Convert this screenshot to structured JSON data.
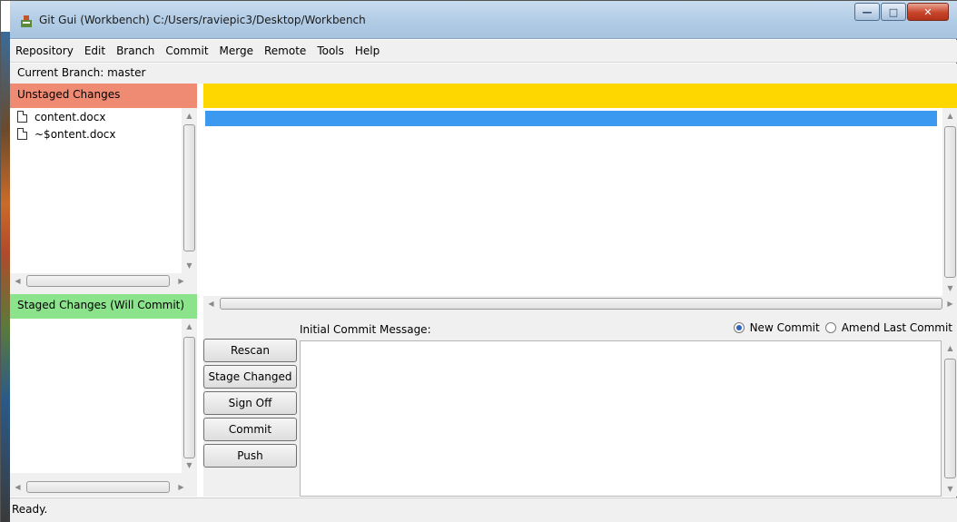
{
  "window": {
    "title": "Git Gui (Workbench) C:/Users/raviepic3/Desktop/Workbench"
  },
  "menu": [
    "Repository",
    "Edit",
    "Branch",
    "Commit",
    "Merge",
    "Remote",
    "Tools",
    "Help"
  ],
  "branch": {
    "text": "Current Branch: master"
  },
  "unstaged": {
    "header": "Unstaged Changes",
    "color": "#f08b73",
    "files": [
      "content.docx",
      "~$ontent.docx"
    ]
  },
  "staged": {
    "header": "Staged Changes (Will Commit)",
    "color": "#8be48b",
    "files": []
  },
  "diff": {
    "header_color": "#ffd700",
    "selection_color": "#3c99f0"
  },
  "commit": {
    "label": "Initial Commit Message:",
    "options": {
      "new": "New Commit",
      "amend": "Amend Last Commit",
      "selected": "new"
    },
    "buttons": {
      "rescan": "Rescan",
      "stage_changed": "Stage Changed",
      "sign_off": "Sign Off",
      "commit": "Commit",
      "push": "Push"
    },
    "message": ""
  },
  "status": {
    "text": "Ready."
  }
}
